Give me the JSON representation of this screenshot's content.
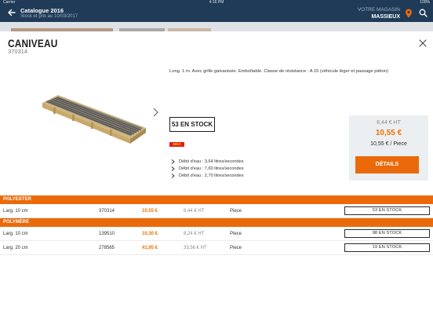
{
  "statusbar": {
    "carrier": "Carrier",
    "time": "4:16 PM",
    "battery": "100%"
  },
  "header": {
    "title": "Catalogue 2016",
    "subtitle": "Stock et prix au 10/03/2017",
    "store_label": "VOTRE MAGASIN",
    "store_name": "MASSIEUX"
  },
  "product": {
    "name": "CANIVEAU",
    "reference": "370314",
    "description": "Long. 1 m. Avec grille galvanisée. Emboîtable. Classe de résistance : A 15 (véhicule léger et passage piéton)",
    "stock": "53 EN STOCK",
    "badge": "MEA",
    "flows": [
      "Débit d'eau : 3,64 litres/secondes",
      "Débit d'eau : 7,60 litres/secondes",
      "Débit d'eau : 2,70 litres/secondes"
    ],
    "price_ht": "8,44 € HT",
    "price_ttc": "10,55 €",
    "price_unit": "10,55 € / Piece",
    "details_label": "DÉTAILS"
  },
  "variants": [
    {
      "section": "POLYESTER",
      "rows": [
        {
          "dimension": "Larg. 10 cm",
          "ref": "370314",
          "ttc": "10,55 €",
          "ht": "8,44 € HT",
          "unit": "Piece",
          "stock": "53 EN STOCK"
        }
      ]
    },
    {
      "section": "POLYMÈRE",
      "rows": [
        {
          "dimension": "Larg. 10 cm",
          "ref": "139510",
          "ttc": "10,30 €",
          "ht": "8,24 € HT",
          "unit": "Piece",
          "stock": "98 EN STOCK"
        },
        {
          "dimension": "Larg. 20 cm",
          "ref": "278565",
          "ttc": "41,95 €",
          "ht": "33,56 € HT",
          "unit": "Piece",
          "stock": "19 EN STOCK"
        }
      ]
    }
  ],
  "colors": {
    "header": "#1f3b57",
    "accent": "#ea6a0b",
    "price": "#f07000"
  },
  "icons": [
    "back-arrow-icon",
    "location-pin-icon",
    "search-icon",
    "close-icon",
    "chevron-right-icon"
  ]
}
